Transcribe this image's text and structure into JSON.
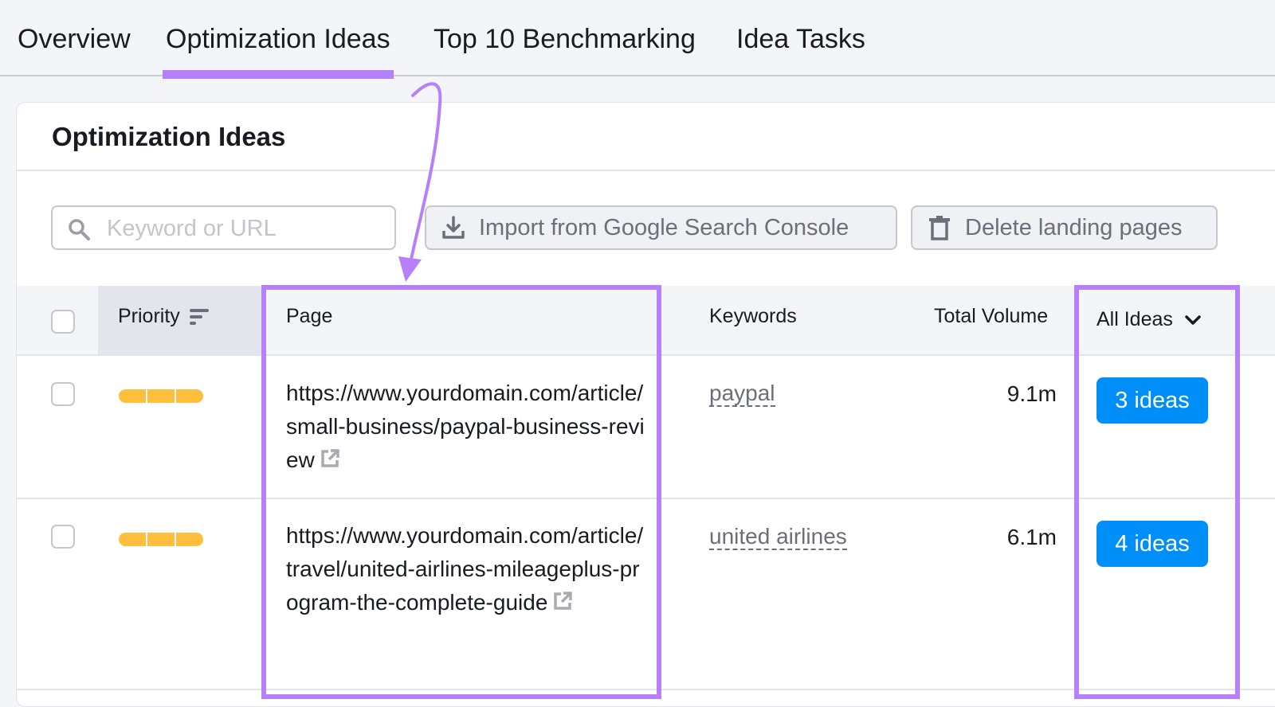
{
  "tabs": [
    {
      "label": "Overview",
      "active": false
    },
    {
      "label": "Optimization Ideas",
      "active": true
    },
    {
      "label": "Top 10 Benchmarking",
      "active": false
    },
    {
      "label": "Idea Tasks",
      "active": false
    }
  ],
  "card": {
    "title": "Optimization Ideas"
  },
  "toolbar": {
    "search_placeholder": "Keyword or URL",
    "search_value": "",
    "import_label": "Import from Google Search Console",
    "delete_label": "Delete landing pages"
  },
  "table": {
    "headers": {
      "priority": "Priority",
      "page": "Page",
      "keywords": "Keywords",
      "total_volume": "Total Volume",
      "ideas_filter": "All Ideas"
    },
    "rows": [
      {
        "priority_level": 3,
        "page": "https://www.yourdomain.com/article/small-business/paypal-business-review",
        "keyword": "paypal",
        "volume": "9.1m",
        "ideas": "3 ideas"
      },
      {
        "priority_level": 3,
        "page": "https://www.yourdomain.com/article/travel/united-airlines-mileageplus-program-the-complete-guide",
        "keyword": "united airlines",
        "volume": "6.1m",
        "ideas": "4 ideas"
      }
    ]
  },
  "colors": {
    "accent_highlight": "#b680fb",
    "ideas_button": "#008ff8",
    "priority_bar": "#ffbf3c"
  }
}
